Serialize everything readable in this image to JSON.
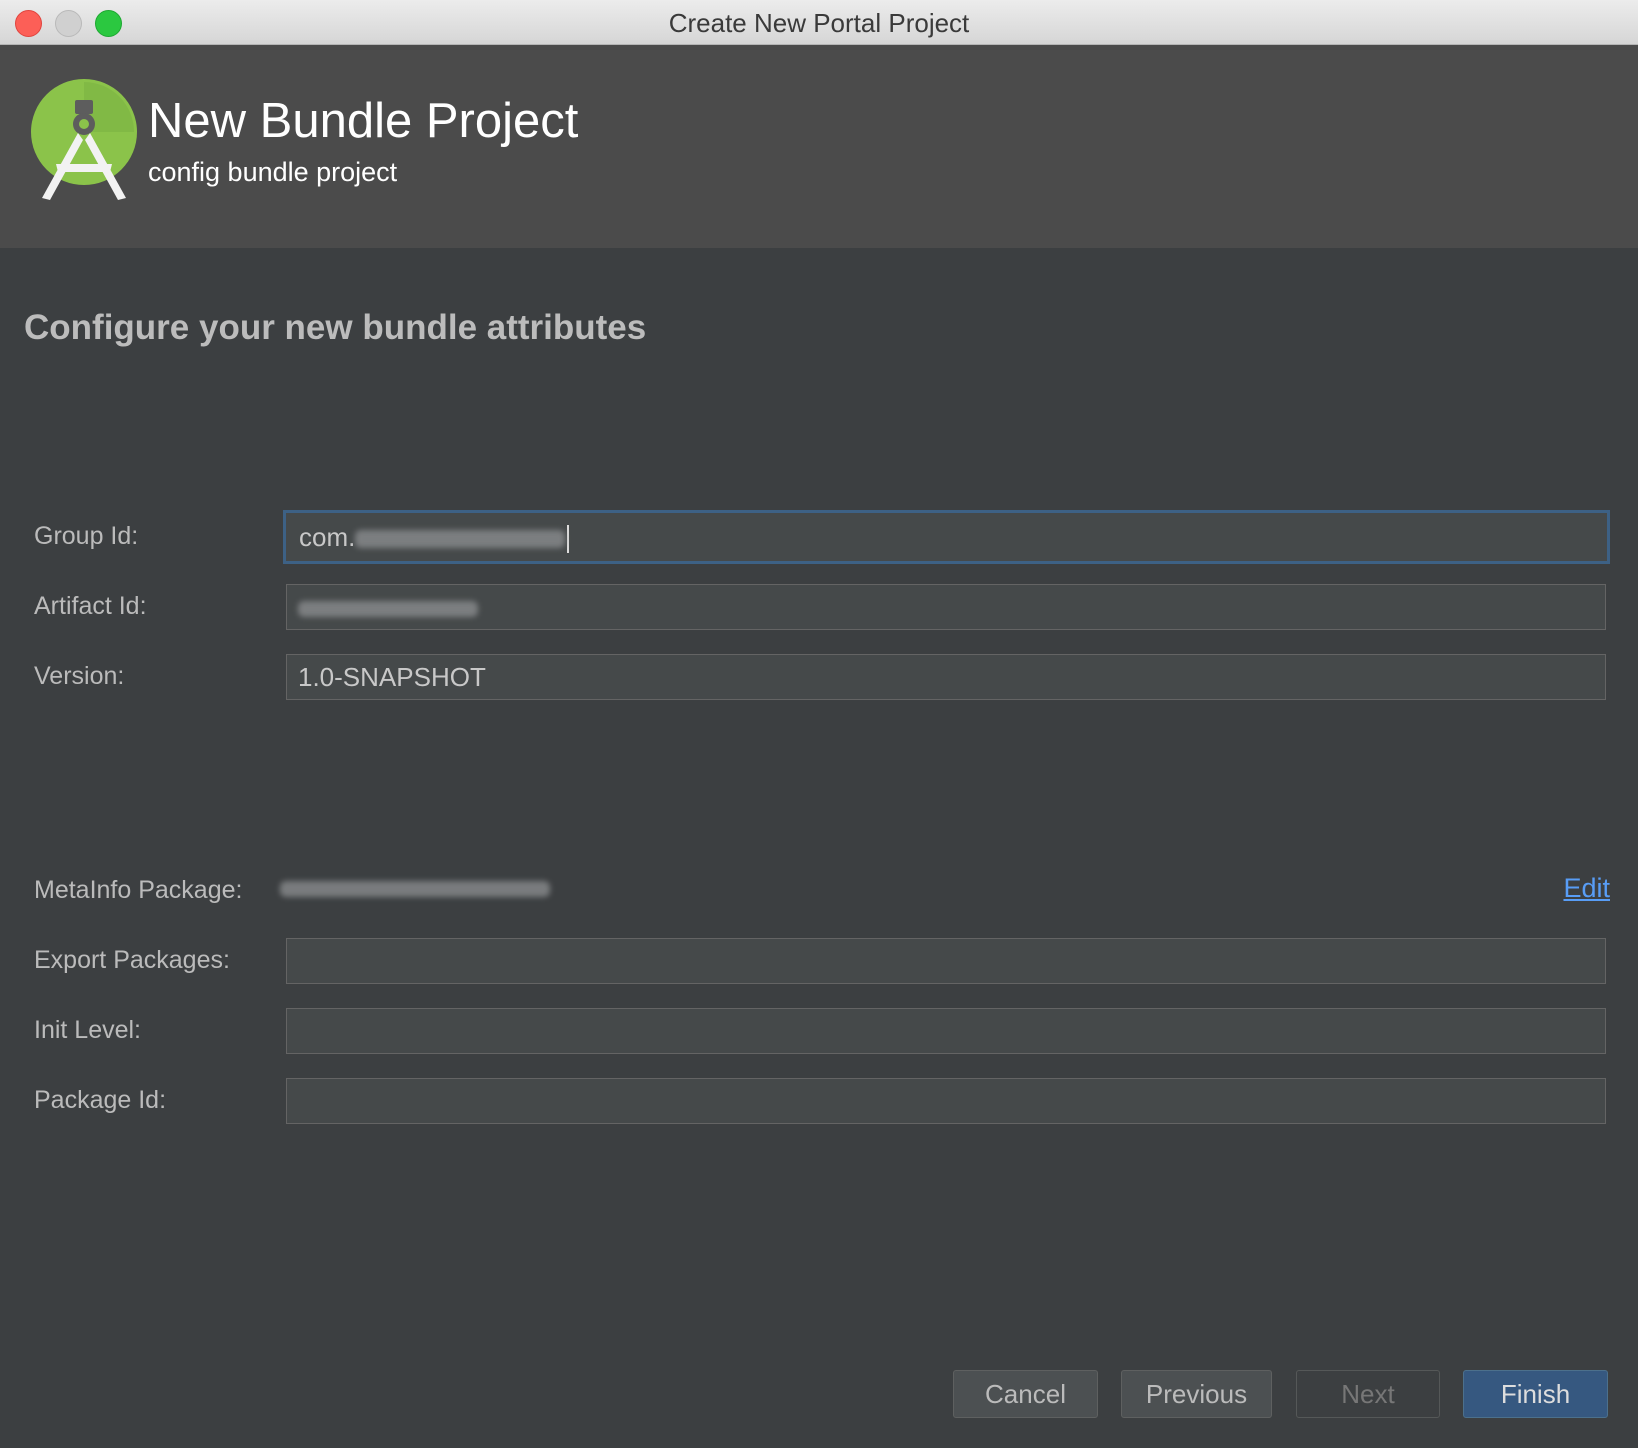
{
  "window": {
    "title": "Create New Portal Project"
  },
  "header": {
    "title": "New Bundle Project",
    "subtitle": "config bundle project",
    "logo_icon": "android-studio-icon"
  },
  "main": {
    "heading": "Configure your new bundle attributes",
    "fields": {
      "group_id": {
        "label": "Group Id:",
        "value_prefix": "com."
      },
      "artifact_id": {
        "label": "Artifact Id:",
        "value": ""
      },
      "version": {
        "label": "Version:",
        "value": "1.0-SNAPSHOT"
      },
      "metainfo_package": {
        "label": "MetaInfo Package:",
        "edit_label": "Edit"
      },
      "export_packages": {
        "label": "Export Packages:",
        "value": ""
      },
      "init_level": {
        "label": "Init Level:",
        "value": ""
      },
      "package_id": {
        "label": "Package Id:",
        "value": ""
      }
    }
  },
  "buttons": {
    "cancel": "Cancel",
    "previous": "Previous",
    "next": "Next",
    "finish": "Finish"
  },
  "colors": {
    "window_bg": "#3c3f41",
    "header_bg": "#4b4b4b",
    "focus_border": "#3d6185",
    "link": "#589df6",
    "primary_button": "#365880",
    "logo_green": "#8bc34a"
  }
}
